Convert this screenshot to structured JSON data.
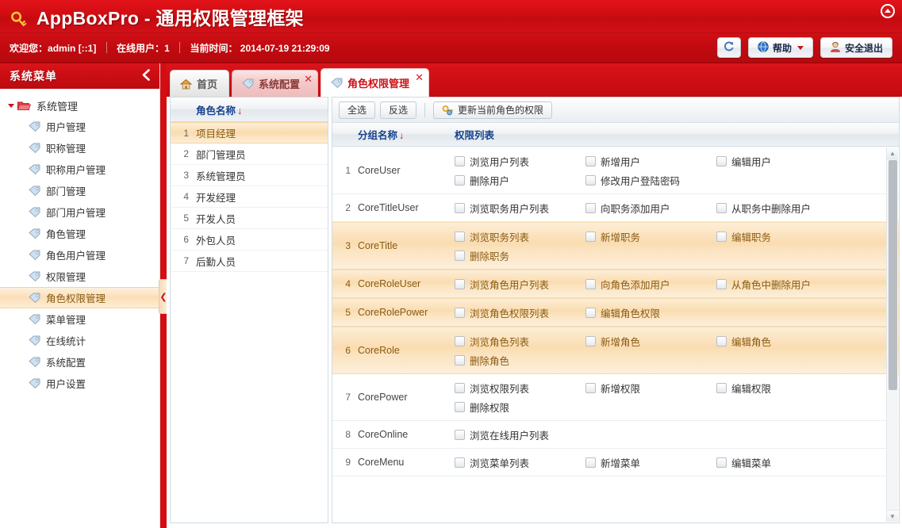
{
  "banner": {
    "brand": "AppBoxPro - 通用权限管理框架",
    "key_icon": "key-icon",
    "collapse_icon": "collapse-up-icon"
  },
  "infobar": {
    "welcome_label": "欢迎您：",
    "user": "admin  [::1]",
    "online_label": "在线用户：",
    "online_count": "1",
    "time_label": "当前时间：",
    "time_value": "2014-07-19 21:29:09",
    "refresh_button": "refresh-icon",
    "help_button": "帮助",
    "logout_button": "安全退出"
  },
  "sidebar": {
    "title": "系统菜单",
    "collapse_icon": "chevron-left-icon",
    "group": "系统管理",
    "handle_icon": "chevron-left-icon",
    "items": [
      {
        "label": "用户管理",
        "active": false
      },
      {
        "label": "职称管理",
        "active": false
      },
      {
        "label": "职称用户管理",
        "active": false
      },
      {
        "label": "部门管理",
        "active": false
      },
      {
        "label": "部门用户管理",
        "active": false
      },
      {
        "label": "角色管理",
        "active": false
      },
      {
        "label": "角色用户管理",
        "active": false
      },
      {
        "label": "权限管理",
        "active": false
      },
      {
        "label": "角色权限管理",
        "active": true
      },
      {
        "label": "菜单管理",
        "active": false
      },
      {
        "label": "在线统计",
        "active": false
      },
      {
        "label": "系统配置",
        "active": false
      },
      {
        "label": "用户设置",
        "active": false
      }
    ]
  },
  "tabs": [
    {
      "label": "首页",
      "closable": false,
      "active": false,
      "kind": "home"
    },
    {
      "label": "系统配置",
      "closable": true,
      "active": false,
      "kind": "conf"
    },
    {
      "label": "角色权限管理",
      "closable": true,
      "active": true,
      "kind": "active"
    }
  ],
  "role_panel": {
    "header_id": "",
    "header_name": "角色名称",
    "sort_arrow": "↓",
    "rows": [
      {
        "id": "1",
        "name": "项目经理",
        "selected": true
      },
      {
        "id": "2",
        "name": "部门管理员",
        "selected": false
      },
      {
        "id": "3",
        "name": "系统管理员",
        "selected": false
      },
      {
        "id": "4",
        "name": "开发经理",
        "selected": false
      },
      {
        "id": "5",
        "name": "开发人员",
        "selected": false
      },
      {
        "id": "6",
        "name": "外包人员",
        "selected": false
      },
      {
        "id": "7",
        "name": "后勤人员",
        "selected": false
      }
    ]
  },
  "perm_panel": {
    "toolbar": {
      "select_all": "全选",
      "invert": "反选",
      "update": "更新当前角色的权限",
      "update_icon": "key-gear-icon"
    },
    "header_group": "分组名称",
    "header_list": "权限列表",
    "sort_arrow": "↓",
    "scroll": {
      "up_icon": "scroll-up-icon",
      "down_icon": "scroll-down-icon"
    },
    "rows": [
      {
        "id": "1",
        "group": "CoreUser",
        "highlight": false,
        "perms": [
          "浏览用户列表",
          "新增用户",
          "编辑用户",
          "删除用户",
          "修改用户登陆密码"
        ]
      },
      {
        "id": "2",
        "group": "CoreTitleUser",
        "highlight": false,
        "perms": [
          "浏览职务用户列表",
          "向职务添加用户",
          "从职务中删除用户"
        ]
      },
      {
        "id": "3",
        "group": "CoreTitle",
        "highlight": true,
        "perms": [
          "浏览职务列表",
          "新增职务",
          "编辑职务",
          "删除职务"
        ]
      },
      {
        "id": "4",
        "group": "CoreRoleUser",
        "highlight": true,
        "perms": [
          "浏览角色用户列表",
          "向角色添加用户",
          "从角色中删除用户"
        ]
      },
      {
        "id": "5",
        "group": "CoreRolePower",
        "highlight": true,
        "perms": [
          "浏览角色权限列表",
          "编辑角色权限"
        ]
      },
      {
        "id": "6",
        "group": "CoreRole",
        "highlight": true,
        "perms": [
          "浏览角色列表",
          "新增角色",
          "编辑角色",
          "删除角色"
        ]
      },
      {
        "id": "7",
        "group": "CorePower",
        "highlight": false,
        "perms": [
          "浏览权限列表",
          "新增权限",
          "编辑权限",
          "删除权限"
        ]
      },
      {
        "id": "8",
        "group": "CoreOnline",
        "highlight": false,
        "perms": [
          "浏览在线用户列表"
        ]
      },
      {
        "id": "9",
        "group": "CoreMenu",
        "highlight": false,
        "perms": [
          "浏览菜单列表",
          "新增菜单",
          "编辑菜单"
        ]
      }
    ]
  },
  "colors": {
    "brand_red": "#cf1016",
    "highlight_orange": "#fadcb0",
    "header_blue": "#15428b"
  }
}
